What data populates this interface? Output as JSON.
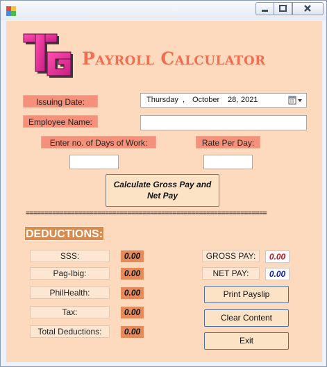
{
  "window": {
    "minimize_icon": "minimize-icon",
    "maximize_icon": "maximize-icon",
    "close_icon": "close-icon"
  },
  "header": {
    "title": "Payroll Calculator",
    "logo_icon": "tg-logo"
  },
  "form": {
    "issuing_date_label": "Issuing Date:",
    "date_day": "Thursday",
    "date_sep": ",",
    "date_month": "October",
    "date_daynum": "28,",
    "date_year": "2021",
    "employee_name_label": "Employee Name:",
    "employee_name_value": "",
    "days_label": "Enter no. of Days of Work:",
    "days_value": "",
    "rate_label": "Rate Per Day:",
    "rate_value": "",
    "calculate_label_line1": "Calculate Gross Pay and",
    "calculate_label_line2": "Net Pay"
  },
  "separator": "================================================================",
  "deductions": {
    "header": "DEDUCTIONS:",
    "items": [
      {
        "label": "SSS:",
        "value": "0.00"
      },
      {
        "label": "Pag-Ibig:",
        "value": "0.00"
      },
      {
        "label": "PhilHealth:",
        "value": "0.00"
      },
      {
        "label": "Tax:",
        "value": "0.00"
      },
      {
        "label": "Total Deductions:",
        "value": "0.00"
      }
    ]
  },
  "pay": {
    "gross_label": "GROSS PAY:",
    "gross_value": "0.00",
    "net_label": "NET PAY:",
    "net_value": "0.00"
  },
  "actions": {
    "print": "Print Payslip",
    "clear": "Clear Content",
    "exit": "Exit"
  },
  "colors": {
    "background": "#fdd9bd",
    "title": "#f26e50",
    "gross_value": "#c0141e",
    "net_value": "#0a1ec8"
  }
}
